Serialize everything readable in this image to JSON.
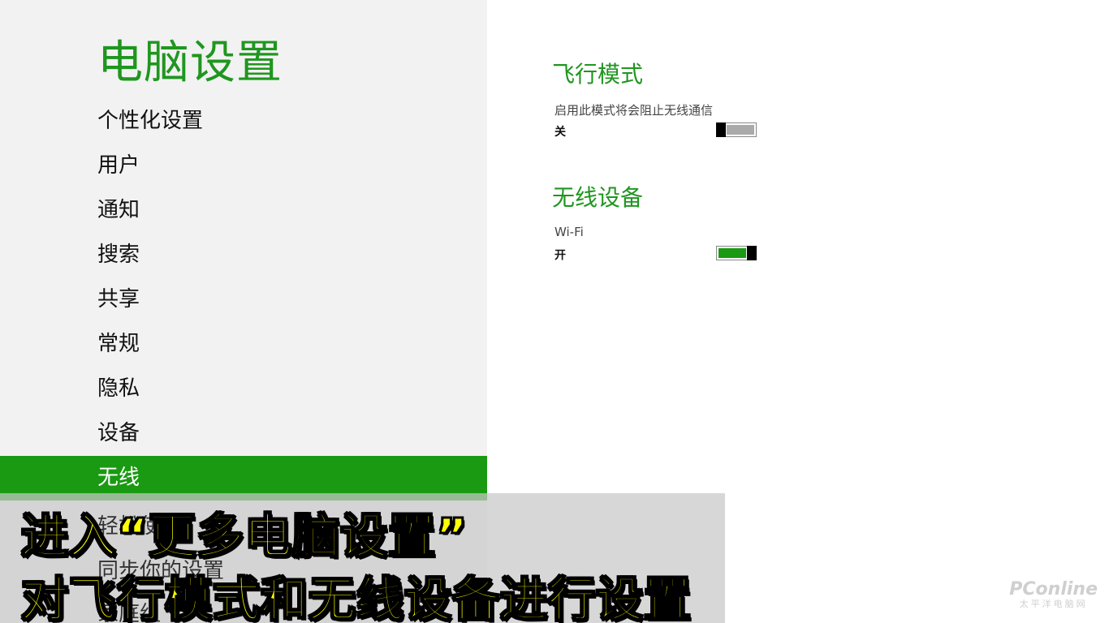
{
  "left_pane": {
    "title": "电脑设置",
    "nav_items": [
      {
        "label": "个性化设置"
      },
      {
        "label": "用户"
      },
      {
        "label": "通知"
      },
      {
        "label": "搜索"
      },
      {
        "label": "共享"
      },
      {
        "label": "常规"
      },
      {
        "label": "隐私"
      },
      {
        "label": "设备"
      },
      {
        "label": "无线",
        "selected": true
      },
      {
        "label": "轻松使用"
      },
      {
        "label": "同步你的设置"
      },
      {
        "label": "家庭组"
      }
    ]
  },
  "airplane": {
    "title": "飞行模式",
    "description": "启用此模式将会阻止无线通信",
    "state": "关",
    "on": false
  },
  "wireless": {
    "title": "无线设备",
    "wifi_label": "Wi-Fi",
    "state": "开",
    "on": true
  },
  "caption": {
    "line1": "进入“更多电脑设置”",
    "line2": "对飞行模式和无线设备进行设置"
  },
  "watermark": {
    "main": "PConline",
    "sub": "太平洋电脑网"
  },
  "colors": {
    "accent": "#1a9a12",
    "left_pane_bg": "#f2f2f2",
    "caption_text": "#ffff00"
  }
}
